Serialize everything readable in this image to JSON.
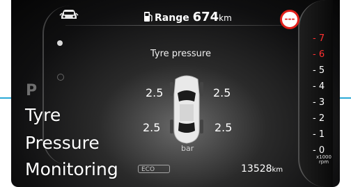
{
  "header": {
    "range_label": "Range",
    "range_value": "674",
    "range_unit": "km",
    "warning_text": "---"
  },
  "main": {
    "title": "Tyre pressure",
    "pressures": {
      "front_left": "2.5",
      "front_right": "2.5",
      "rear_left": "2.5",
      "rear_right": "2.5"
    },
    "unit": "bar"
  },
  "tachometer": {
    "ticks": [
      "7",
      "6",
      "5",
      "4",
      "3",
      "2",
      "1",
      "0"
    ],
    "red_ticks": [
      "7",
      "6"
    ],
    "label_line1": "x1000",
    "label_line2": "rpm"
  },
  "footer": {
    "eco_label": "ECO",
    "odometer_value": "13528",
    "odometer_unit": "km"
  },
  "overlay": {
    "gear_letter": "P",
    "title_lines": [
      "Tyre",
      "Pressure",
      "Monitoring"
    ]
  },
  "colors": {
    "accent_cyan": "#2aa9d6",
    "warning_red": "#e0201b",
    "tick_red": "#ff3030"
  },
  "icons": {
    "car": "car-front-icon",
    "fuel": "fuel-pump-icon",
    "warning": "no-entry-icon"
  }
}
